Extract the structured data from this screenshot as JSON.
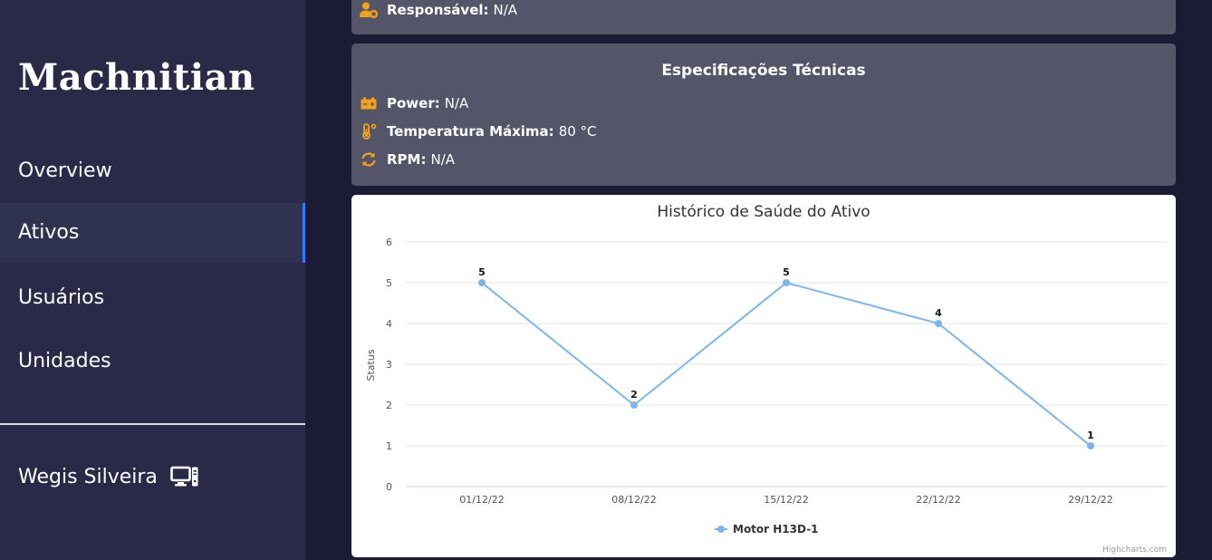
{
  "app": {
    "name": "Machnitian"
  },
  "sidebar": {
    "items": [
      {
        "label": "Overview"
      },
      {
        "label": "Ativos"
      },
      {
        "label": "Usuários"
      },
      {
        "label": "Unidades"
      }
    ],
    "user": {
      "name": "Wegis Silveira",
      "icon": "computer-icon"
    }
  },
  "info": {
    "responsavel": {
      "key": "Responsável:",
      "value": "N/A",
      "icon": "user-gear-icon"
    }
  },
  "specs": {
    "title": "Especificações Técnicas",
    "power": {
      "key": "Power:",
      "value": "N/A",
      "icon": "battery-icon"
    },
    "temp": {
      "key": "Temperatura Máxima:",
      "value": "80 °C",
      "icon": "thermometer-icon"
    },
    "rpm": {
      "key": "RPM:",
      "value": "N/A",
      "icon": "sync-icon"
    }
  },
  "colors": {
    "accent": "#f4a21c",
    "series": "#7cb5ec",
    "active_indicator": "#2f7cff"
  },
  "chart_data": {
    "type": "line",
    "title": "Histórico de Saúde do Ativo",
    "ylabel": "Status",
    "xlabel": "",
    "categories": [
      "01/12/22",
      "08/12/22",
      "15/12/22",
      "22/12/22",
      "29/12/22"
    ],
    "series": [
      {
        "name": "Motor H13D-1",
        "values": [
          5,
          2,
          5,
          4,
          1
        ]
      }
    ],
    "ylim": [
      0,
      6
    ],
    "yticks": [
      0,
      1,
      2,
      3,
      4,
      5,
      6
    ],
    "grid": true,
    "legend": "bottom-center",
    "credits": "Highcharts.com"
  }
}
